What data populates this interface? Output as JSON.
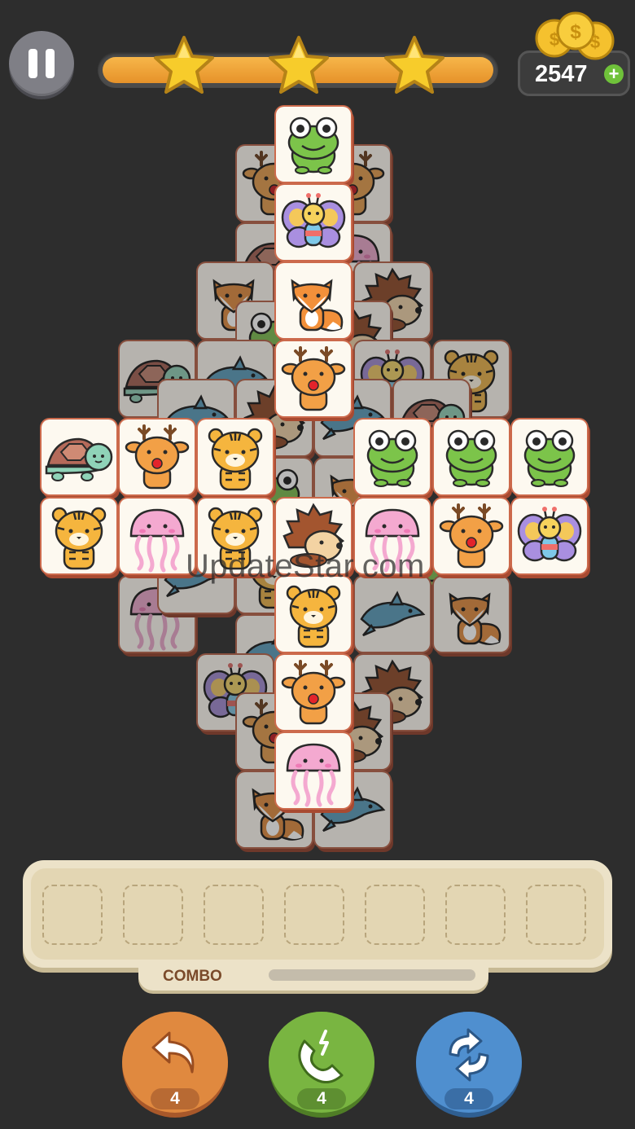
{
  "hud": {
    "coins": "2547",
    "plus_label": "+",
    "stars_earned": 3,
    "level_progress": 1.0
  },
  "board": {
    "tile_icons": [
      "frog-icon",
      "butterfly-icon",
      "fox-icon",
      "deer-icon",
      "turtle-icon",
      "tiger-icon",
      "jellyfish-icon",
      "hedgehog-icon",
      "dolphin-icon"
    ]
  },
  "watermark": "UpdateStar.com",
  "tray": {
    "slots": 7,
    "filled": 0
  },
  "combo": {
    "label": "COMBO",
    "level": 0
  },
  "powerups": [
    {
      "name": "undo",
      "count": "4",
      "color": "#e0893f"
    },
    {
      "name": "magnet",
      "count": "4",
      "color": "#79b541"
    },
    {
      "name": "shuffle",
      "count": "4",
      "color": "#4f8fcf"
    }
  ],
  "colors": {
    "background": "#2d2d2d",
    "tile_face": "#fdf9f0",
    "tile_edge": "#cc6a4c",
    "progress": "#f0a23c"
  }
}
